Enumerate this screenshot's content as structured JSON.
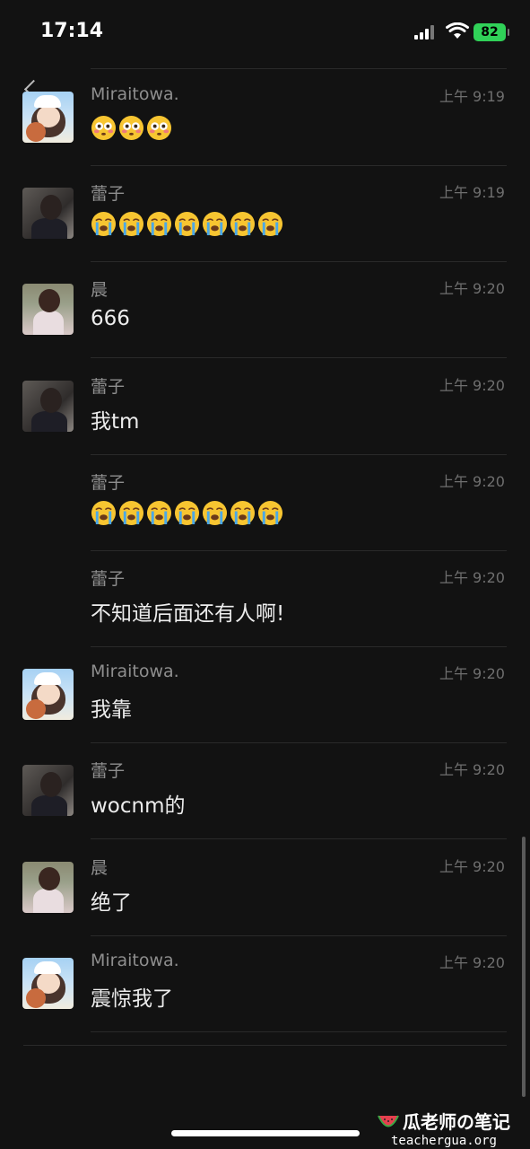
{
  "status_bar": {
    "time": "17:14",
    "battery": "82"
  },
  "messages": [
    {
      "avatar": "avatar-miraitowa",
      "sender": "Miraitowa.",
      "time": "上午 9:19",
      "text": "",
      "emoji": "flushed-face",
      "emoji_count": 3
    },
    {
      "avatar": "avatar-leizi",
      "sender": "蕾子",
      "time": "上午 9:19",
      "text": "",
      "emoji": "loudly-crying-face",
      "emoji_count": 7
    },
    {
      "avatar": "avatar-chen",
      "sender": "晨",
      "time": "上午 9:20",
      "text": "666"
    },
    {
      "avatar": "avatar-leizi",
      "sender": "蕾子",
      "time": "上午 9:20",
      "text": "我tm"
    },
    {
      "avatar": "",
      "sender": "蕾子",
      "time": "上午 9:20",
      "text": "",
      "emoji": "loudly-crying-face",
      "emoji_count": 7
    },
    {
      "avatar": "",
      "sender": "蕾子",
      "time": "上午 9:20",
      "text": "不知道后面还有人啊!"
    },
    {
      "avatar": "avatar-miraitowa",
      "sender": "Miraitowa.",
      "time": "上午 9:20",
      "text": "我靠"
    },
    {
      "avatar": "avatar-leizi",
      "sender": "蕾子",
      "time": "上午 9:20",
      "text": "wocnm的"
    },
    {
      "avatar": "avatar-chen",
      "sender": "晨",
      "time": "上午 9:20",
      "text": "绝了"
    },
    {
      "avatar": "avatar-miraitowa",
      "sender": "Miraitowa.",
      "time": "上午 9:20",
      "text": "震惊我了"
    }
  ],
  "watermark": {
    "title": "瓜老师の笔记",
    "url": "teachergua.org"
  },
  "colors": {
    "background": "#121212",
    "battery": "#30d158",
    "emoji_yellow": "#f7c531",
    "tears": "#4aa8e8"
  }
}
